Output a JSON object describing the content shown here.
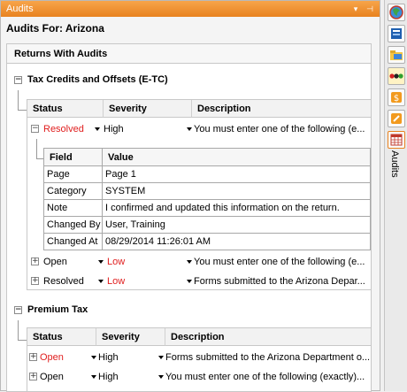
{
  "window": {
    "title": "Audits",
    "pin_glyph": "▾",
    "dock_glyph": "⊣"
  },
  "audits_for": "Audits For: Arizona",
  "section_title": "Returns With Audits",
  "groups": [
    {
      "label": "Tax Credits and Offsets (E-TC)",
      "columns": [
        "Status",
        "Severity",
        "Description"
      ],
      "rows": [
        {
          "status": "Resolved",
          "severity": "High",
          "description": "You must enter one of the following (e...",
          "expanded": true
        },
        {
          "status": "Open",
          "severity": "Low",
          "description": "You must enter one of the following (e..."
        },
        {
          "status": "Resolved",
          "severity": "Low",
          "description": "Forms submitted to the Arizona Depar..."
        }
      ],
      "detail": {
        "columns": [
          "Field",
          "Value"
        ],
        "rows": [
          {
            "field": "Page",
            "value": "Page 1"
          },
          {
            "field": "Category",
            "value": "SYSTEM"
          },
          {
            "field": "Note",
            "value": "I confirmed and updated this information on the return."
          },
          {
            "field": "Changed By",
            "value": "User, Training"
          },
          {
            "field": "Changed At",
            "value": "08/29/2014  11:26:01 AM"
          }
        ]
      }
    },
    {
      "label": "Premium Tax",
      "columns": [
        "Status",
        "Severity",
        "Description"
      ],
      "rows": [
        {
          "status": "Open",
          "severity": "High",
          "description": "Forms submitted to the Arizona Department o..."
        },
        {
          "status": "Open",
          "severity": "High",
          "description": "You must enter one of the following (exactly)..."
        }
      ]
    }
  ],
  "sidebar": {
    "tabs": [
      "globe-icon",
      "book-icon",
      "folder-icon",
      "traffic-light-icon",
      "badge-icon",
      "stamp-icon",
      "audits-grid-icon"
    ],
    "vertical_label": "Audits"
  },
  "colors": {
    "titlebar": "#e8821f",
    "alert_red": "#e01e1e"
  }
}
